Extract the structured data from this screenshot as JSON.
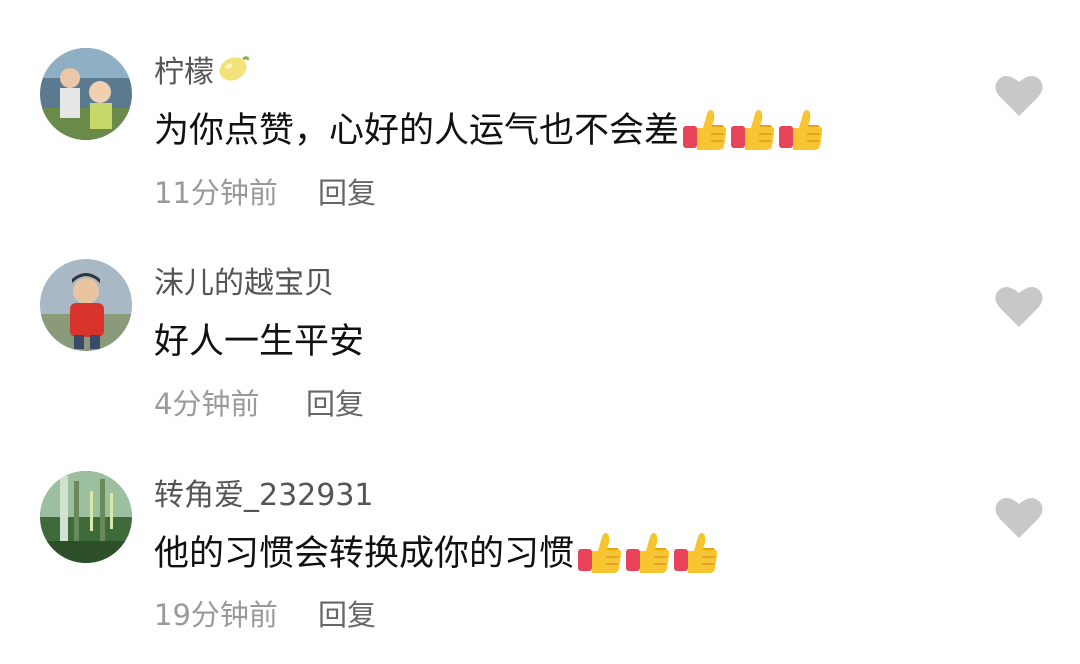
{
  "comments": [
    {
      "username": "柠檬",
      "username_emoji": "lemon-icon",
      "text": "为你点赞，心好的人运气也不会差",
      "thumbs_count": 3,
      "time": "11分钟前",
      "reply_label": "回复",
      "liked": false
    },
    {
      "username": "沫儿的越宝贝",
      "text": "好人一生平安",
      "thumbs_count": 0,
      "time": "4分钟前",
      "reply_label": "回复",
      "liked": false
    },
    {
      "username": "转角爱_232931",
      "text": "他的习惯会转换成你的习惯",
      "thumbs_count": 3,
      "time": "19分钟前",
      "reply_label": "回复",
      "liked": false
    }
  ],
  "icons": {
    "like": "heart-icon",
    "reaction": "thumbs-up-icon"
  },
  "colors": {
    "heart": "#c8c8c8",
    "meta_text": "#9a9a9a",
    "username_text": "#555555",
    "thumb_yellow": "#f7c531",
    "thumb_sleeve": "#e9435a"
  }
}
